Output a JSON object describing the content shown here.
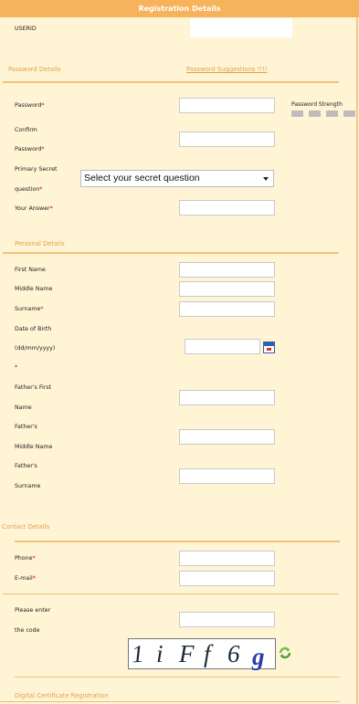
{
  "header": {
    "title": "Registration Details"
  },
  "userid": {
    "label": "USERID"
  },
  "password_section": {
    "title": "Password Details",
    "suggestions_link": "Password Suggestions !!!!",
    "password_label": "Password",
    "confirm_label_1": "Confirm",
    "confirm_label_2": "Password",
    "secret_label_1": "Primary Secret",
    "secret_label_2": "question",
    "secret_placeholder": "Select your secret question",
    "answer_label": "Your Answer",
    "strength_label": "Password Strength",
    "required_mark": "*"
  },
  "personal_section": {
    "title": "Personal Details",
    "first_name_label": "First Name",
    "middle_name_label": "Middle Name",
    "surname_label": "Surname",
    "dob_label_1": "Date of Birth",
    "dob_label_2": "(dd/mm/yyyy)",
    "father_first_1": "Father's First",
    "father_first_2": "Name",
    "father_middle_1": "Father's",
    "father_middle_2": "Middle Name",
    "father_surname_1": "Father's",
    "father_surname_2": "Surname"
  },
  "contact_section": {
    "title": "Contact Details",
    "phone_label": "Phone",
    "email_label": "E-mail"
  },
  "captcha": {
    "prompt_1": "Please enter",
    "prompt_2": "the code",
    "code_chars": [
      "1",
      "i",
      "F",
      "f",
      "6",
      "g"
    ],
    "colors": {
      "primary": "#1a2a3a",
      "last": "#2a3ab0"
    },
    "refresh_icon": "refresh-icon"
  },
  "certificate_section": {
    "title": "Digital Certificate Registration"
  },
  "colors": {
    "header_bg": "#f6b35c",
    "page_bg": "#fff4d4",
    "section_text": "#e0a050",
    "divider": "#f4c27a"
  }
}
